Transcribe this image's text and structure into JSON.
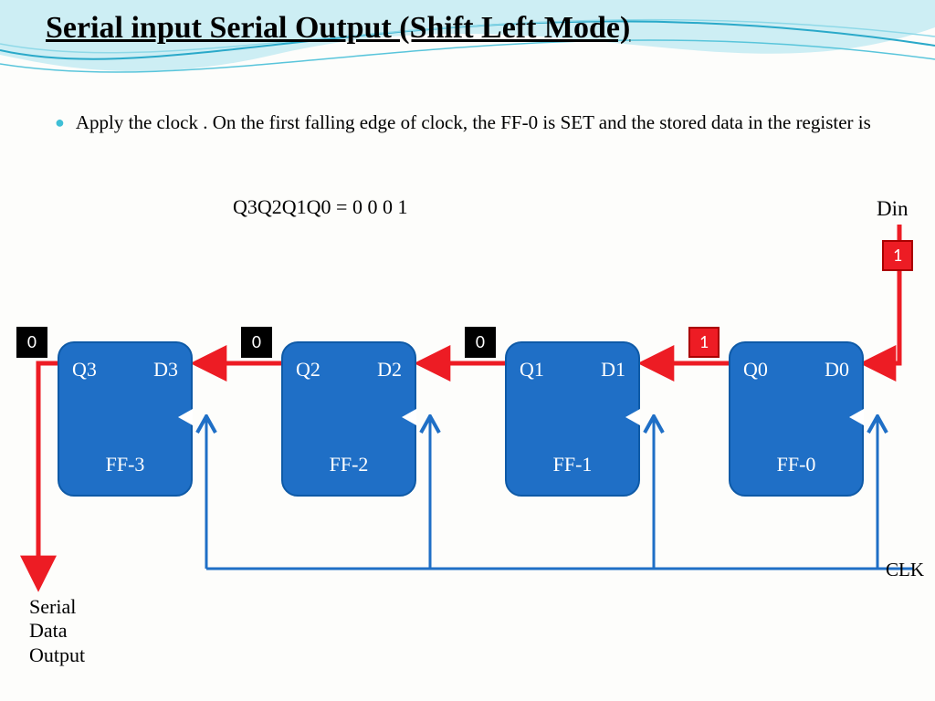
{
  "title": "Serial input Serial Output (Shift Left Mode)",
  "bullet": "Apply the clock . On the first falling edge of clock, the FF-0 is SET and the stored data in the register is",
  "state_equation": "Q3Q2Q1Q0 = 0 0 0 1",
  "din_label": "Din",
  "din_value": "1",
  "clk_label": "CLK",
  "serial_out_label_lines": [
    "Serial",
    "Data",
    "Output"
  ],
  "flipflops": [
    {
      "name": "FF-3",
      "q": "Q3",
      "d": "D3",
      "value": "0",
      "value_color": "black"
    },
    {
      "name": "FF-2",
      "q": "Q2",
      "d": "D2",
      "value": "0",
      "value_color": "black"
    },
    {
      "name": "FF-1",
      "q": "Q1",
      "d": "D1",
      "value": "0",
      "value_color": "black"
    },
    {
      "name": "FF-0",
      "q": "Q0",
      "d": "D0",
      "value": "1",
      "value_color": "red"
    }
  ],
  "colors": {
    "accent": "#1f6fc6",
    "arrow_red": "#ed1c24",
    "arrow_blue": "#1f6fc6",
    "wave_light": "#bfe9f2",
    "wave_dark": "#2aa9c9"
  }
}
